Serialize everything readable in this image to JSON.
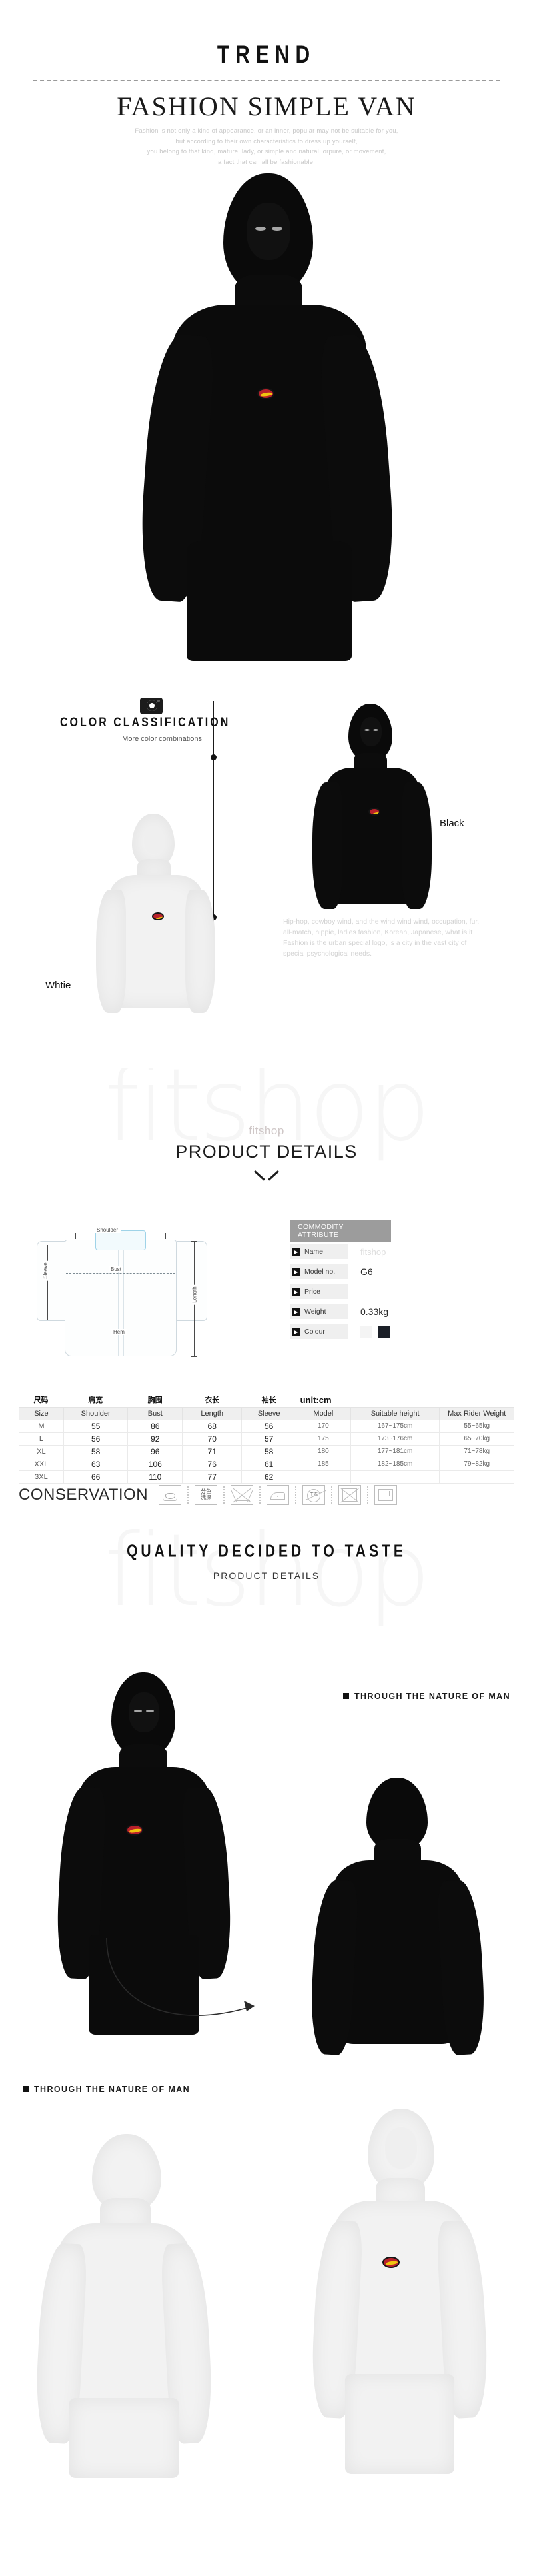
{
  "hero": {
    "kicker": "TREND",
    "title": "FASHION SIMPLE VAN",
    "paragraph_lines": [
      "Fashion is not only a kind of appearance, or an inner, popular may not be suitable for you,",
      "but according to their own characteristics to dress up yourself,",
      "you belong to that kind, mature, lady, or simple and natural, orpure, or movement,",
      "a fact that can all be fashionable."
    ]
  },
  "color_classification": {
    "icon": "camera-icon",
    "title": "COLOR CLASSIFICATION",
    "subtitle": "More color combinations",
    "options": [
      {
        "label": "Whtie",
        "swatch": "#f2f2f2"
      },
      {
        "label": "Black",
        "swatch": "#0b0b0b"
      }
    ],
    "description": "Hip-hop, cowboy wind, and the wind wind wind, occupation, fur, all-match, hippie, ladies fashion, Korean, Japanese, what is it Fashion is the urban special logo, is a city in the vast city of special psychological needs."
  },
  "brand": {
    "name": "fitshop",
    "watermark": "fitshop"
  },
  "details_section": {
    "brand_label": "fitshop",
    "title": "PRODUCT DETAILS",
    "chevron": "chevron-down-icon"
  },
  "measurements": {
    "labels": {
      "shoulder": "Shoulder",
      "bust": "Bust",
      "hem": "Hem",
      "sleeve": "Sleeve",
      "length": "Length"
    }
  },
  "commodity_attributes": {
    "header": "COMMODITY ATTRIBUTE",
    "rows": [
      {
        "key": "Name",
        "value": "fitshop",
        "type": "brand"
      },
      {
        "key": "Model no.",
        "value": "G6",
        "type": "text"
      },
      {
        "key": "Price",
        "value": "",
        "type": "text"
      },
      {
        "key": "Weight",
        "value": "0.33kg",
        "type": "text"
      },
      {
        "key": "Colour",
        "value": "",
        "type": "swatches",
        "swatches": [
          "#f4f4f4",
          "#1b1f27"
        ]
      }
    ]
  },
  "size_table": {
    "cn_headers": [
      "尺码",
      "肩宽",
      "胸围",
      "衣长",
      "袖长"
    ],
    "unit": "unit:cm",
    "headers": [
      "Size",
      "Shoulder",
      "Bust",
      "Length",
      "Sleeve",
      "Model",
      "Suitable height",
      "Max Rider Weight"
    ],
    "rows": [
      [
        "M",
        "55",
        "86",
        "68",
        "56",
        "170",
        "167~175cm",
        "55~65kg"
      ],
      [
        "L",
        "56",
        "92",
        "70",
        "57",
        "175",
        "173~176cm",
        "65~70kg"
      ],
      [
        "XL",
        "58",
        "96",
        "71",
        "58",
        "180",
        "177~181cm",
        "71~78kg"
      ],
      [
        "XXL",
        "63",
        "106",
        "76",
        "61",
        "185",
        "182~185cm",
        "79~82kg"
      ],
      [
        "3XL",
        "66",
        "110",
        "77",
        "62",
        "",
        "",
        ""
      ]
    ]
  },
  "conservation": {
    "title": "CONSERVATION",
    "icons": [
      {
        "name": "hand-wash-icon",
        "cn": ""
      },
      {
        "name": "separate-wash-icon",
        "cn": "分色\n洗涤"
      },
      {
        "name": "no-bleach-icon",
        "cn": ""
      },
      {
        "name": "iron-icon",
        "cn": ""
      },
      {
        "name": "no-dry-clean-icon",
        "cn": "干洗"
      },
      {
        "name": "no-tumble-dry-icon",
        "cn": ""
      },
      {
        "name": "flat-dry-icon",
        "cn": ""
      }
    ]
  },
  "quality_section": {
    "title": "QUALITY DECIDED TO TASTE",
    "subtitle": "PRODUCT DETAILS"
  },
  "nature_labels": {
    "right": "THROUGH THE NATURE OF MAN",
    "left": "THROUGH THE NATURE OF MAN"
  }
}
